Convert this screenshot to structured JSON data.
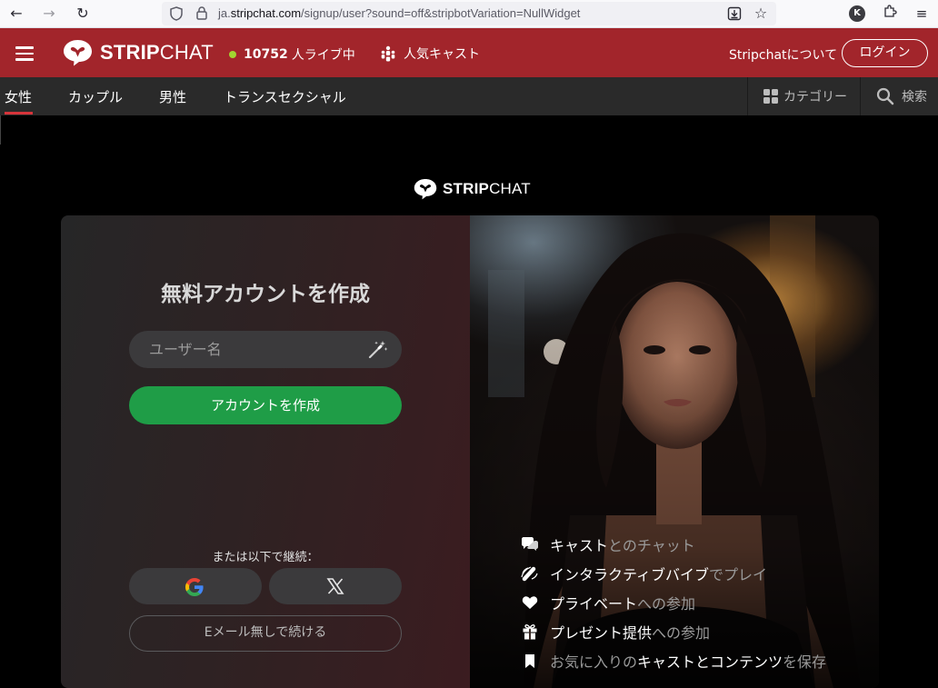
{
  "browser": {
    "url_prefix": "ja.",
    "url_domain": "stripchat.com",
    "url_path": "/signup/user?sound=off&stripbotVariation=NullWidget",
    "profile_initial": "K"
  },
  "header": {
    "logo_bold": "STRIP",
    "logo_light": "CHAT",
    "live_count": "10752",
    "live_label": "人ライブ中",
    "popular_label": "人気キャスト",
    "about_label": "Stripchatについて",
    "login_label": "ログイン"
  },
  "categories": {
    "tabs": [
      {
        "label": "女性",
        "active": true
      },
      {
        "label": "カップル",
        "active": false
      },
      {
        "label": "男性",
        "active": false
      },
      {
        "label": "トランスセクシャル",
        "active": false
      }
    ],
    "category_label": "カテゴリー",
    "search_label": "検索"
  },
  "signup": {
    "logo_bold": "STRIP",
    "logo_light": "CHAT",
    "title": "無料アカウントを作成",
    "username_placeholder": "ユーザー名",
    "create_label": "アカウントを作成",
    "or_continue": "または以下で継続：",
    "no_email_label": "Eメール無しで続ける"
  },
  "features": [
    {
      "icon": "chat-icon",
      "bright": "キャスト",
      "dim": "とのチャット"
    },
    {
      "icon": "vibrator-icon",
      "bright": "インタラクティブバイブ",
      "dim": "でプレイ"
    },
    {
      "icon": "heart-icon",
      "bright": "プライベート",
      "dim": "への参加"
    },
    {
      "icon": "gift-icon",
      "bright": "プレゼント提供",
      "dim": "への参加"
    },
    {
      "icon": "bookmark-icon",
      "bright": "お気に入りのキャストとコンテンツ",
      "dim": "を保存",
      "first_dim": "お気に入りの",
      "bright2": "キャストとコンテンツ"
    }
  ],
  "colors": {
    "brand_red": "#a2252b",
    "live_dot": "#a2d530",
    "create_green": "#1f9d47",
    "catbar": "#2a2a2a"
  }
}
